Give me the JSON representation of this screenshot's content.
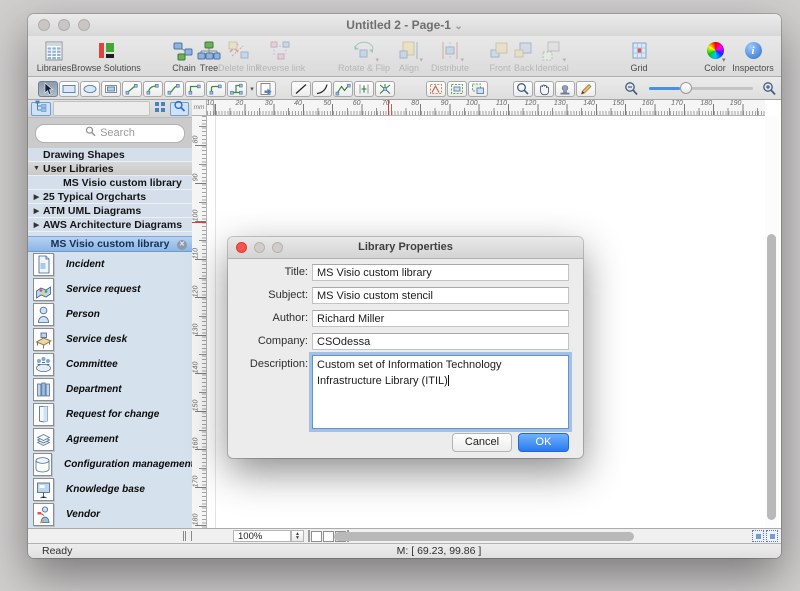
{
  "window": {
    "title": "Untitled 2 - Page-1"
  },
  "toolbar": {
    "groups": [
      [
        {
          "label": "Libraries",
          "icon": "libraries",
          "enabled": true
        },
        {
          "label": "Browse Solutions",
          "icon": "browse-solutions",
          "enabled": true
        }
      ],
      [
        {
          "label": "Chain",
          "icon": "chain",
          "enabled": true
        },
        {
          "label": "Tree",
          "icon": "tree",
          "enabled": true
        },
        {
          "label": "Delete link",
          "icon": "delete-link",
          "enabled": false
        },
        {
          "label": "Reverse link",
          "icon": "reverse-link",
          "enabled": false
        }
      ],
      [
        {
          "label": "Rotate & Flip",
          "icon": "rotate-flip",
          "enabled": false,
          "caret": true
        },
        {
          "label": "Align",
          "icon": "align",
          "enabled": false,
          "caret": true
        },
        {
          "label": "Distribute",
          "icon": "distribute",
          "enabled": false,
          "caret": true
        }
      ],
      [
        {
          "label": "Front",
          "icon": "front",
          "enabled": false
        },
        {
          "label": "Back",
          "icon": "back",
          "enabled": false
        },
        {
          "label": "Identical",
          "icon": "identical",
          "enabled": false,
          "caret": true
        }
      ],
      [
        {
          "label": "Grid",
          "icon": "grid",
          "enabled": true
        }
      ],
      [
        {
          "label": "Color",
          "icon": "color",
          "enabled": true,
          "caret": true
        },
        {
          "label": "Inspectors",
          "icon": "inspectors",
          "enabled": true
        }
      ]
    ]
  },
  "tools": {
    "selected": "select",
    "groups": [
      [
        "select",
        "rectangle",
        "ellipse",
        "text-frame",
        "connector-direct",
        "connector-arc",
        "connector-bezier",
        "connector-elbow",
        "connector-rounded",
        "connector-tree",
        "dropdown",
        "insert-object"
      ],
      [
        "line",
        "arc",
        "polyline",
        "midline",
        "spline"
      ],
      [
        "reshape-skew",
        "reshape-group",
        "reshape-scale"
      ],
      [
        "zoom",
        "hand",
        "stamp",
        "pencil"
      ]
    ]
  },
  "sidebar": {
    "search_placeholder": "Search",
    "tree_items": [
      {
        "label": "Drawing Shapes",
        "arrow": "",
        "indent": 0,
        "row": "blue"
      },
      {
        "label": "User Libraries",
        "arrow": "down",
        "indent": 0,
        "row": "gray"
      },
      {
        "label": "MS Visio custom library",
        "arrow": "",
        "indent": 1,
        "row": "blue"
      },
      {
        "label": "25 Typical Orgcharts",
        "arrow": "right",
        "indent": 0,
        "row": "blue"
      },
      {
        "label": "ATM UML Diagrams",
        "arrow": "right",
        "indent": 0,
        "row": "blue"
      },
      {
        "label": "AWS Architecture Diagrams",
        "arrow": "right",
        "indent": 0,
        "row": "blue"
      }
    ],
    "library_header": "MS Visio custom library",
    "library_items": [
      {
        "label": "Incident",
        "icon": "document"
      },
      {
        "label": "Service request",
        "icon": "service-map"
      },
      {
        "label": "Person",
        "icon": "person"
      },
      {
        "label": "Service desk",
        "icon": "desk"
      },
      {
        "label": "Committee",
        "icon": "committee"
      },
      {
        "label": "Department",
        "icon": "department"
      },
      {
        "label": "Request for change",
        "icon": "page"
      },
      {
        "label": "Agreement",
        "icon": "stack"
      },
      {
        "label": "Configuration management ...",
        "icon": "database"
      },
      {
        "label": "Knowledge base",
        "icon": "board"
      },
      {
        "label": "Vendor",
        "icon": "vendor"
      }
    ]
  },
  "rulers": {
    "unit": "mm",
    "h_labels": [
      "10",
      "20",
      "30",
      "40",
      "50",
      "60",
      "70",
      "80",
      "90",
      "100",
      "110",
      "120",
      "130",
      "140",
      "150",
      "160",
      "170",
      "180",
      "190"
    ],
    "v_labels": [
      "80",
      "90",
      "100",
      "110",
      "120",
      "130",
      "140",
      "150",
      "160",
      "170",
      "180"
    ]
  },
  "dialog": {
    "title": "Library Properties",
    "fields": [
      {
        "label": "Title:",
        "value": "MS Visio custom library"
      },
      {
        "label": "Subject:",
        "value": "MS Visio custom stencil"
      },
      {
        "label": "Author:",
        "value": "Richard Miller"
      },
      {
        "label": "Company:",
        "value": "CSOdessa"
      }
    ],
    "description_label": "Description:",
    "description_value": "Custom set of Information Technology Infrastructure Library (ITIL)",
    "cancel_label": "Cancel",
    "ok_label": "OK"
  },
  "minibar": {
    "zoom_value": "100%"
  },
  "statusbar": {
    "ready": "Ready",
    "mouse": "M: [ 69.23, 99.86 ]"
  }
}
